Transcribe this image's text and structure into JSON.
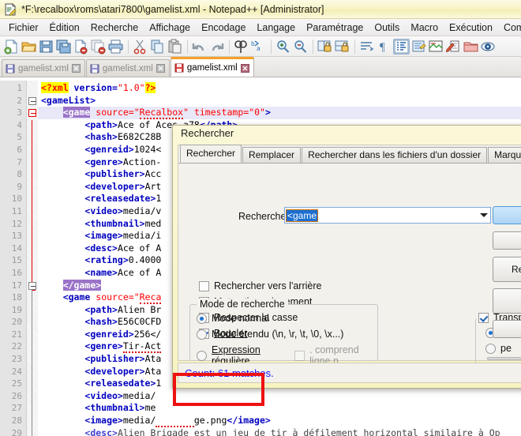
{
  "window": {
    "title": "*F:\\recalbox\\roms\\atari7800\\gamelist.xml - Notepad++ [Administrator]",
    "app_icon": "notepad-plus-plus-icon"
  },
  "menu": {
    "items": [
      {
        "label": "Fichier"
      },
      {
        "label": "Édition"
      },
      {
        "label": "Recherche"
      },
      {
        "label": "Affichage"
      },
      {
        "label": "Encodage"
      },
      {
        "label": "Langage"
      },
      {
        "label": "Paramétrage"
      },
      {
        "label": "Outils"
      },
      {
        "label": "Macro"
      },
      {
        "label": "Exécution"
      },
      {
        "label": "Complér"
      }
    ]
  },
  "toolbar": {
    "icons": [
      "new-file-icon",
      "open-file-icon",
      "save-icon",
      "save-all-icon",
      "close-file-icon",
      "close-all-icon",
      "print-icon",
      "cut-icon",
      "copy-icon",
      "paste-icon",
      "undo-icon",
      "redo-icon",
      "find-icon",
      "replace-icon",
      "zoom-in-icon",
      "zoom-out-icon",
      "sync-vertical-icon",
      "sync-horizontal-icon",
      "word-wrap-icon",
      "show-all-characters-icon",
      "indent-guide-icon",
      "user-language-icon",
      "document-map-icon",
      "function-list-icon",
      "folder-as-workspace-icon",
      "monitoring-icon"
    ]
  },
  "tabs": [
    {
      "label": "gamelist.xml",
      "active": false,
      "icon": "saved-disk-icon",
      "close": "close-icon"
    },
    {
      "label": "gamelist.xml",
      "active": false,
      "icon": "saved-disk-icon",
      "close": "close-icon"
    },
    {
      "label": "gamelist.xml",
      "active": true,
      "icon": "modified-disk-icon",
      "close": "close-icon"
    }
  ],
  "editor": {
    "line_numbers": [
      1,
      2,
      3,
      4,
      5,
      6,
      7,
      8,
      9,
      10,
      11,
      12,
      13,
      14,
      15,
      16,
      17,
      18,
      19,
      20,
      21,
      22,
      23,
      24,
      25,
      26,
      27,
      28,
      29
    ],
    "lines": [
      {
        "n": 1,
        "text": "<?xml version=\"1.0\"?>"
      },
      {
        "n": 2,
        "text": "<gameList>"
      },
      {
        "n": 3,
        "text": "    <game source=\"Recalbox\" timestamp=\"0\">"
      },
      {
        "n": 4,
        "text": "        <path>Ace of Aces a78</path>"
      },
      {
        "n": 5,
        "text": "        <hash>E682C28B"
      },
      {
        "n": 6,
        "text": "        <genreid>1024<"
      },
      {
        "n": 7,
        "text": "        <genre>Action-"
      },
      {
        "n": 8,
        "text": "        <publisher>Acc"
      },
      {
        "n": 9,
        "text": "        <developer>Art"
      },
      {
        "n": 10,
        "text": "        <releasedate>1"
      },
      {
        "n": 11,
        "text": "        <video>media/v"
      },
      {
        "n": 12,
        "text": "        <thumbnail>med"
      },
      {
        "n": 13,
        "text": "        <image>media/i"
      },
      {
        "n": 14,
        "text": "        <desc>Ace of A"
      },
      {
        "n": 15,
        "text": "        <rating>0.4000"
      },
      {
        "n": 16,
        "text": "        <name>Ace of A"
      },
      {
        "n": 17,
        "text": "    </game>"
      },
      {
        "n": 18,
        "text": "    <game source=\"Reca"
      },
      {
        "n": 19,
        "text": "        <path>Alien Br"
      },
      {
        "n": 20,
        "text": "        <hash>E56C0CFD"
      },
      {
        "n": 21,
        "text": "        <genreid>256</"
      },
      {
        "n": 22,
        "text": "        <genre>Tir-Act"
      },
      {
        "n": 23,
        "text": "        <publisher>Ata"
      },
      {
        "n": 24,
        "text": "        <developer>Ata"
      },
      {
        "n": 25,
        "text": "        <releasedate>1"
      },
      {
        "n": 26,
        "text": "        <video>media/"
      },
      {
        "n": 27,
        "text": "        <thumbnail>me"
      },
      {
        "n": 28,
        "text": "        <image>media/...ge.png</image>"
      },
      {
        "n": 29,
        "text": "        <desc>Alien Brigade est un jeu de tir à défilement horizontal similaire à Op"
      }
    ]
  },
  "find_dialog": {
    "title": "Rechercher",
    "tabs": [
      {
        "label": "Rechercher",
        "active": true
      },
      {
        "label": "Remplacer",
        "active": false
      },
      {
        "label": "Rechercher dans les fichiers d'un dossier",
        "active": false
      },
      {
        "label": "Marquer",
        "active": false
      }
    ],
    "search_label": "Recherche :",
    "search_value": "<game",
    "options": [
      {
        "label": "Rechercher vers l'arrière",
        "checked": false
      },
      {
        "label": "Mot entier uniquement",
        "checked": false
      },
      {
        "label": "Respecter la casse",
        "checked": false
      },
      {
        "label": "Boucler",
        "checked": true
      }
    ],
    "mode_group": {
      "title": "Mode de recherche",
      "options": [
        {
          "label": "Mode normal",
          "selected": true
        },
        {
          "label": "Mode étendu (\\n, \\r, \\t, \\0, \\x...)",
          "selected": false
        },
        {
          "label": "Expression régulière",
          "selected": false
        }
      ],
      "dotmatch_label": ". comprend ligne n",
      "dotmatch_checked": false
    },
    "transparency": {
      "label": "Transp",
      "checked": true,
      "options": [
        {
          "label": "à l",
          "selected": true
        },
        {
          "label": "pe",
          "selected": false
        }
      ]
    },
    "buttons": [
      {
        "label": "",
        "primary": true
      },
      {
        "label": "",
        "primary": false
      },
      {
        "label": "Rech\nd",
        "primary": false
      },
      {
        "label": "R",
        "primary": false
      },
      {
        "label": "",
        "primary": false
      }
    ],
    "status": "Count: 61 matches."
  },
  "annotation": {
    "color": "#ee1111",
    "target": "Count: 61 matches."
  },
  "colors": {
    "titlebar": "#f7f3c4",
    "accent_tab": "#f5a028",
    "tag": "#0000c0",
    "attribute": "#ff0000",
    "highlight": "#ffff00",
    "selection": "#9a73c8",
    "status_text": "#1414ff",
    "annotation": "#ee1111"
  }
}
